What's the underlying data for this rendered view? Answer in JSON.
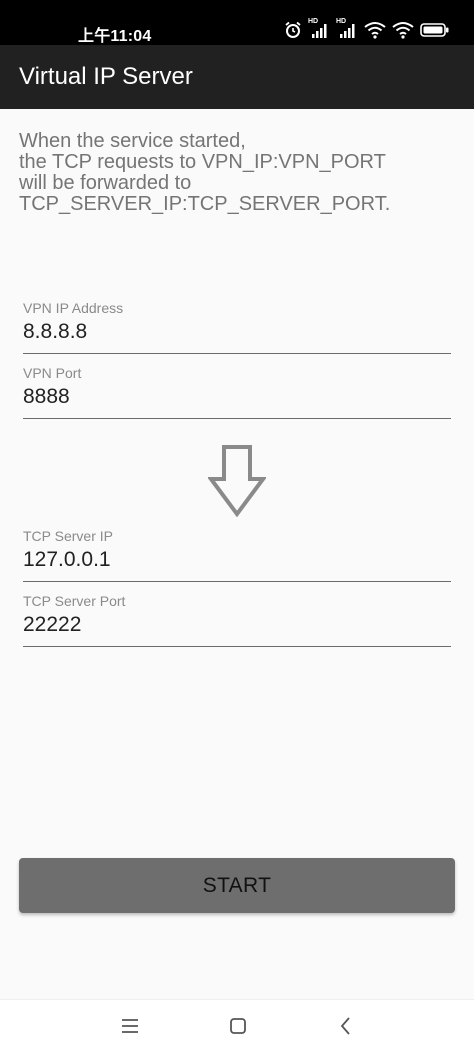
{
  "status_bar": {
    "time": "上午11:04",
    "icons": [
      "alarm-icon",
      "signal-hd-icon",
      "signal-hd-icon",
      "wifi-icon",
      "wifi-icon",
      "battery-icon"
    ],
    "hd_label": "HD"
  },
  "app_bar": {
    "title": "Virtual IP Server"
  },
  "intro": {
    "lines": [
      "When the service started,",
      "the TCP requests to VPN_IP:VPN_PORT",
      "will be forwarded to",
      "TCP_SERVER_IP:TCP_SERVER_PORT."
    ]
  },
  "vpn": {
    "ip_label": "VPN IP Address",
    "ip_value": "8.8.8.8",
    "port_label": "VPN Port",
    "port_value": "8888"
  },
  "arrow_icon": "arrow-down-icon",
  "tcp": {
    "ip_label": "TCP Server IP",
    "ip_value": "127.0.0.1",
    "port_label": "TCP Server Port",
    "port_value": "22222"
  },
  "start_button": {
    "label": "START"
  },
  "nav_bar": {
    "icons": [
      "menu-icon",
      "home-icon",
      "back-icon"
    ]
  },
  "colors": {
    "status_bar": "#000000",
    "app_bar": "#212121",
    "background": "#fafafa",
    "button": "#6e6e6e",
    "intro_text": "#757575"
  }
}
